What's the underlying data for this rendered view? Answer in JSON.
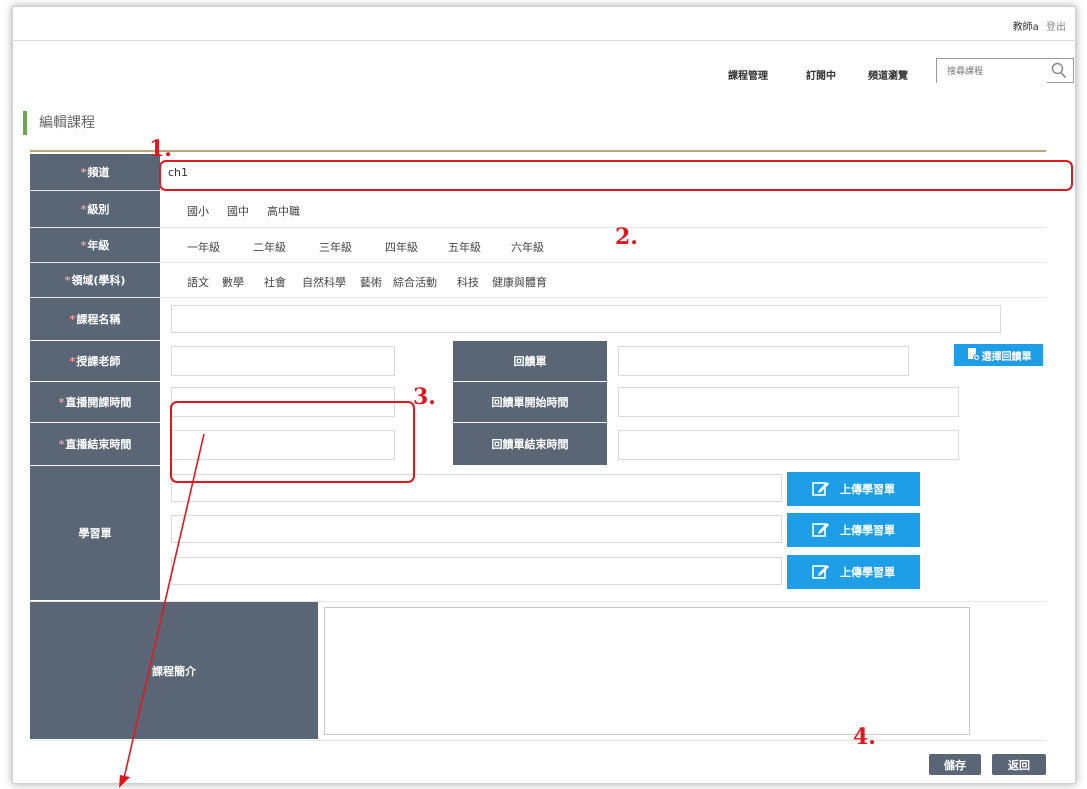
{
  "header": {
    "user_name": "教師a",
    "logout_label": "登出",
    "nav": [
      "課程管理",
      "訂閱中",
      "頻道瀏覽"
    ],
    "search_placeholder": "搜尋課程"
  },
  "page_title": "編輯課程",
  "form": {
    "channel": {
      "label": "頻道",
      "value": "ch1"
    },
    "level": {
      "label": "級別",
      "options": [
        "國小",
        "國中",
        "高中職"
      ]
    },
    "grade": {
      "label": "年級",
      "options": [
        "一年級",
        "二年級",
        "三年級",
        "四年級",
        "五年級",
        "六年級"
      ]
    },
    "domain": {
      "label": "領域(學科)",
      "options": [
        "語文",
        "數學",
        "社會",
        "自然科學",
        "藝術",
        "綜合活動",
        "科技",
        "健康與體育"
      ]
    },
    "course_name": {
      "label": "課程名稱",
      "value": ""
    },
    "teacher": {
      "label": "授課老師",
      "value": ""
    },
    "live_start": {
      "label": "直播開課時間",
      "value": ""
    },
    "live_end": {
      "label": "直播結束時間",
      "value": ""
    },
    "feedback": {
      "label": "回饋單",
      "value": "",
      "select_button": "選擇回饋單"
    },
    "feedback_start": {
      "label": "回饋單開始時間",
      "value": ""
    },
    "feedback_end": {
      "label": "回饋單結束時間",
      "value": ""
    },
    "worksheet": {
      "label": "學習單",
      "upload_label": "上傳學習單"
    },
    "intro": {
      "label": "課程簡介",
      "value": ""
    }
  },
  "buttons": {
    "save": "儲存",
    "back": "返回"
  },
  "annotations": [
    "1.",
    "2.",
    "3.",
    "4."
  ],
  "colors": {
    "label_bg": "#5a6675",
    "accent_blue": "#1e9ee6",
    "annotation_red": "#e0181e",
    "heading_bar": "#6aa84f"
  }
}
